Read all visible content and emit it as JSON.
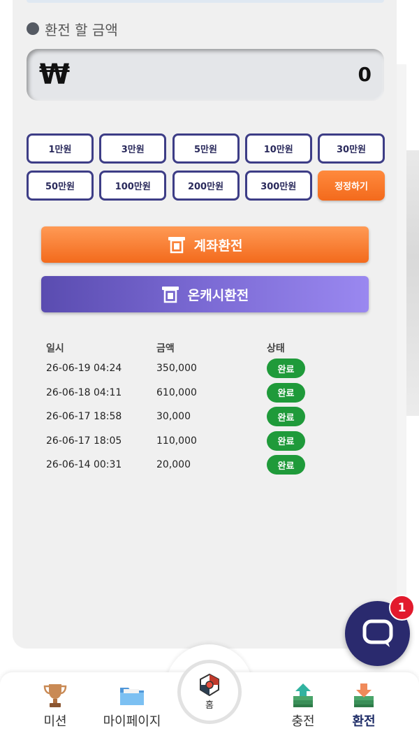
{
  "withdraw": {
    "section_title": "환전 할 금액",
    "currency_symbol": "₩",
    "amount_value": "0",
    "quick_amounts": [
      "1만원",
      "3만원",
      "5만원",
      "10만원",
      "30만원",
      "50만원",
      "100만원",
      "200만원",
      "300만원"
    ],
    "reset_label": "정정하기",
    "account_button_label": "계좌환전",
    "oncash_button_label": "온캐시환전"
  },
  "history": {
    "headers": {
      "date": "일시",
      "amount": "금액",
      "status": "상태"
    },
    "rows": [
      {
        "date": "26-06-19 04:24",
        "amount": "350,000",
        "status": "완료"
      },
      {
        "date": "26-06-18 04:11",
        "amount": "610,000",
        "status": "완료"
      },
      {
        "date": "26-06-17 18:58",
        "amount": "30,000",
        "status": "완료"
      },
      {
        "date": "26-06-17 18:05",
        "amount": "110,000",
        "status": "완료"
      },
      {
        "date": "26-06-14 00:31",
        "amount": "20,000",
        "status": "완료"
      }
    ]
  },
  "chat": {
    "badge_count": "1",
    "icon": "chat-bubble-icon"
  },
  "bottom_nav": {
    "mission": {
      "label": "미션",
      "icon": "trophy-icon"
    },
    "mypage": {
      "label": "마이페이지",
      "icon": "folder-icon"
    },
    "home": {
      "label": "홈",
      "icon": "home-logo-icon"
    },
    "charge": {
      "label": "충전",
      "icon": "money-upload-icon"
    },
    "withdraw": {
      "label": "환전",
      "icon": "money-download-icon",
      "active": true
    }
  },
  "colors": {
    "accent_orange": "#f36a1c",
    "accent_purple": "#7b6ad4",
    "chip_border": "#3d3d86",
    "status_green": "#1f9a3a",
    "badge_red": "#e21a2d",
    "chat_navy": "#2a2a6e"
  }
}
